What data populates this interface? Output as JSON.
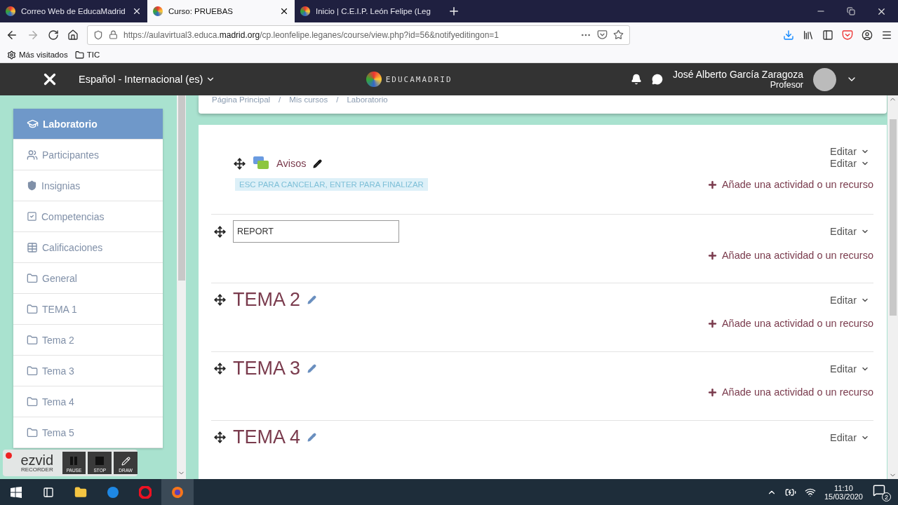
{
  "browser": {
    "tabs": [
      {
        "title": "Correo Web de EducaMadrid",
        "selected": false
      },
      {
        "title": "Curso: PRUEBAS",
        "selected": true
      },
      {
        "title": "Inicio | C.E.I.P. León Felipe (Leg",
        "selected": false
      }
    ],
    "url": "https://aulavirtual3.educa.**madrid.org**/cp.leonfelipe.leganes/course/view.php?id=56&notifyeditingon=1",
    "bookmarks": [
      {
        "kind": "gear",
        "label": "Más visitados"
      },
      {
        "kind": "folder",
        "label": "TIC"
      }
    ]
  },
  "header": {
    "language": "Español - Internacional (es)",
    "logo": "EDUCAMADRID",
    "user_name": "José Alberto García Zaragoza",
    "user_role": "Profesor"
  },
  "sidebar": {
    "items": [
      {
        "kind": "course",
        "label": "Laboratorio",
        "selected": true
      },
      {
        "kind": "participants",
        "label": "Participantes",
        "selected": false
      },
      {
        "kind": "badges",
        "label": "Insignias",
        "selected": false
      },
      {
        "kind": "competencies",
        "label": "Competencias",
        "selected": false
      },
      {
        "kind": "grades",
        "label": "Calificaciones",
        "selected": false
      },
      {
        "kind": "section",
        "label": "General",
        "selected": false
      },
      {
        "kind": "section",
        "label": "TEMA 1",
        "selected": false
      },
      {
        "kind": "section",
        "label": "Tema 2",
        "selected": false
      },
      {
        "kind": "section",
        "label": "Tema 3",
        "selected": false
      },
      {
        "kind": "section",
        "label": "Tema 4",
        "selected": false
      },
      {
        "kind": "section",
        "label": "Tema 5",
        "selected": false
      }
    ]
  },
  "breadcrumb": [
    {
      "label": "Página Principal"
    },
    {
      "separator": "/",
      "label": "Mis cursos"
    },
    {
      "separator": "/",
      "label": "Laboratorio"
    }
  ],
  "sections": [
    {
      "kind": "activities",
      "edit": "Editar",
      "activity": {
        "name": "Avisos",
        "edit": "Editar"
      },
      "hint": "ESC PARA CANCELAR, ENTER PARA FINALIZAR",
      "add": "Añade una actividad o un recurso"
    },
    {
      "kind": "editing",
      "value": "REPORT",
      "edit": "Editar",
      "add": "Añade una actividad o un recurso"
    },
    {
      "kind": "title",
      "title": "TEMA 2",
      "edit": "Editar",
      "add": "Añade una actividad o un recurso"
    },
    {
      "kind": "title",
      "title": "TEMA 3",
      "edit": "Editar",
      "add": "Añade una actividad o un recurso"
    },
    {
      "kind": "title",
      "title": "TEMA 4",
      "edit": "Editar"
    }
  ],
  "recorder": {
    "brand": "ezvid",
    "sub": "RECORDER",
    "buttons": [
      {
        "kind": "pause",
        "label": "PAUSE"
      },
      {
        "kind": "stop",
        "label": "STOP"
      },
      {
        "kind": "draw",
        "label": "DRAW"
      }
    ]
  },
  "taskbar": {
    "time": "11:10",
    "date": "15/03/2020",
    "notifications": "2"
  }
}
